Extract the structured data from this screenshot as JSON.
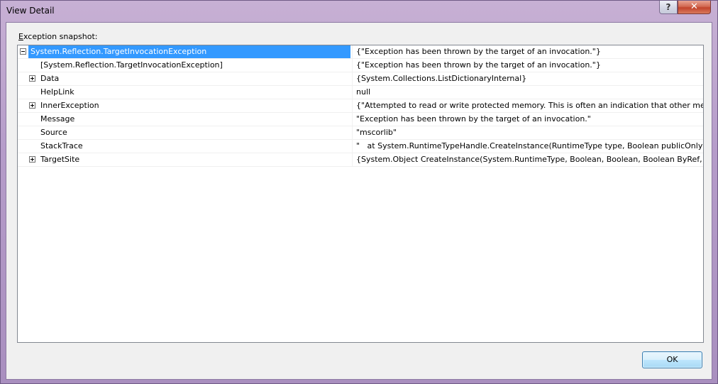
{
  "window": {
    "title": "View Detail",
    "help_label": "?",
    "close_label": "✕"
  },
  "snapshot": {
    "label_prefix": "E",
    "label_rest": "xception snapshot:"
  },
  "rows": [
    {
      "name": "System.Reflection.TargetInvocationException",
      "value": "{\"Exception has been thrown by the target of an invocation.\"}"
    },
    {
      "name": "[System.Reflection.TargetInvocationException]",
      "value": "{\"Exception has been thrown by the target of an invocation.\"}"
    },
    {
      "name": "Data",
      "value": "{System.Collections.ListDictionaryInternal}"
    },
    {
      "name": "HelpLink",
      "value": "null"
    },
    {
      "name": "InnerException",
      "value": "{\"Attempted to read or write protected memory. This is often an indication that other memory is corrupt.\"}"
    },
    {
      "name": "Message",
      "value": "\"Exception has been thrown by the target of an invocation.\""
    },
    {
      "name": "Source",
      "value": "\"mscorlib\""
    },
    {
      "name": "StackTrace",
      "value": "\"   at System.RuntimeTypeHandle.CreateInstance(RuntimeType type, Boolean publicOnly, Boolean noCheck, Boolean& canBeCached, RuntimeMethodHandle& ctor, Boolean& bNeedSecurityCheck)"
    },
    {
      "name": "TargetSite",
      "value": "{System.Object CreateInstance(System.RuntimeType, Boolean, Boolean, Boolean ByRef, System.RuntimeMethodHandle ByRef, Boolean ByRef)}"
    }
  ],
  "buttons": {
    "ok_label": "OK"
  }
}
